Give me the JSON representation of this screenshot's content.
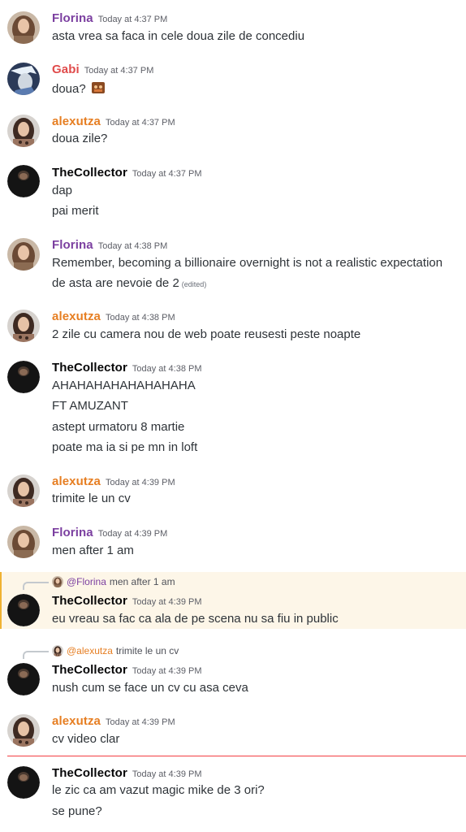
{
  "colors": {
    "florina": "#7b3fa0",
    "gabi": "#e04b4b",
    "alexutza": "#e67e22",
    "collector": "#060607",
    "highlight_bg": "#fdf6e8",
    "new_divider": "#f23f43"
  },
  "messages": [
    {
      "author": "Florina",
      "time": "Today at 4:37 PM",
      "lines": [
        "asta vrea sa faca in cele doua zile de concediu"
      ]
    },
    {
      "author": "Gabi",
      "time": "Today at 4:37 PM",
      "lines": [
        "doua?"
      ]
    },
    {
      "author": "alexutza",
      "time": "Today at 4:37 PM",
      "lines": [
        "doua zile?"
      ]
    },
    {
      "author": "TheCollector",
      "time": "Today at 4:37 PM",
      "lines": [
        "dap",
        "pai merit"
      ]
    },
    {
      "author": "Florina",
      "time": "Today at 4:38 PM",
      "lines": [
        "Remember, becoming a billionaire overnight is not a realistic expectation",
        "de asta are nevoie de 2"
      ],
      "edited": "(edited)"
    },
    {
      "author": "alexutza",
      "time": "Today at 4:38 PM",
      "lines": [
        "2 zile cu camera nou de web poate reusesti peste noapte"
      ]
    },
    {
      "author": "TheCollector",
      "time": "Today at 4:38 PM",
      "lines": [
        "AHAHAHAHAHAHAHAHA",
        "FT AMUZANT",
        "astept urmatoru 8 martie",
        "poate ma ia si pe mn in loft"
      ]
    },
    {
      "author": "alexutza",
      "time": "Today at 4:39 PM",
      "lines": [
        "trimite le un cv"
      ]
    },
    {
      "author": "Florina",
      "time": "Today at 4:39 PM",
      "lines": [
        "men after 1 am"
      ]
    },
    {
      "author": "TheCollector",
      "time": "Today at 4:39 PM",
      "reply_to": "@Florina",
      "reply_text": "men after 1 am",
      "lines": [
        "eu vreau sa fac ca ala de pe scena nu sa fiu in public"
      ]
    },
    {
      "author": "TheCollector",
      "time": "Today at 4:39 PM",
      "reply_to": "@alexutza",
      "reply_text": "trimite le un cv",
      "lines": [
        "nush cum se face un cv cu asa ceva"
      ]
    },
    {
      "author": "alexutza",
      "time": "Today at 4:39 PM",
      "lines": [
        "cv video clar"
      ]
    },
    {
      "author": "TheCollector",
      "time": "Today at 4:39 PM",
      "lines": [
        "le zic ca am vazut magic mike de 3 ori?",
        "se pune?"
      ]
    }
  ]
}
